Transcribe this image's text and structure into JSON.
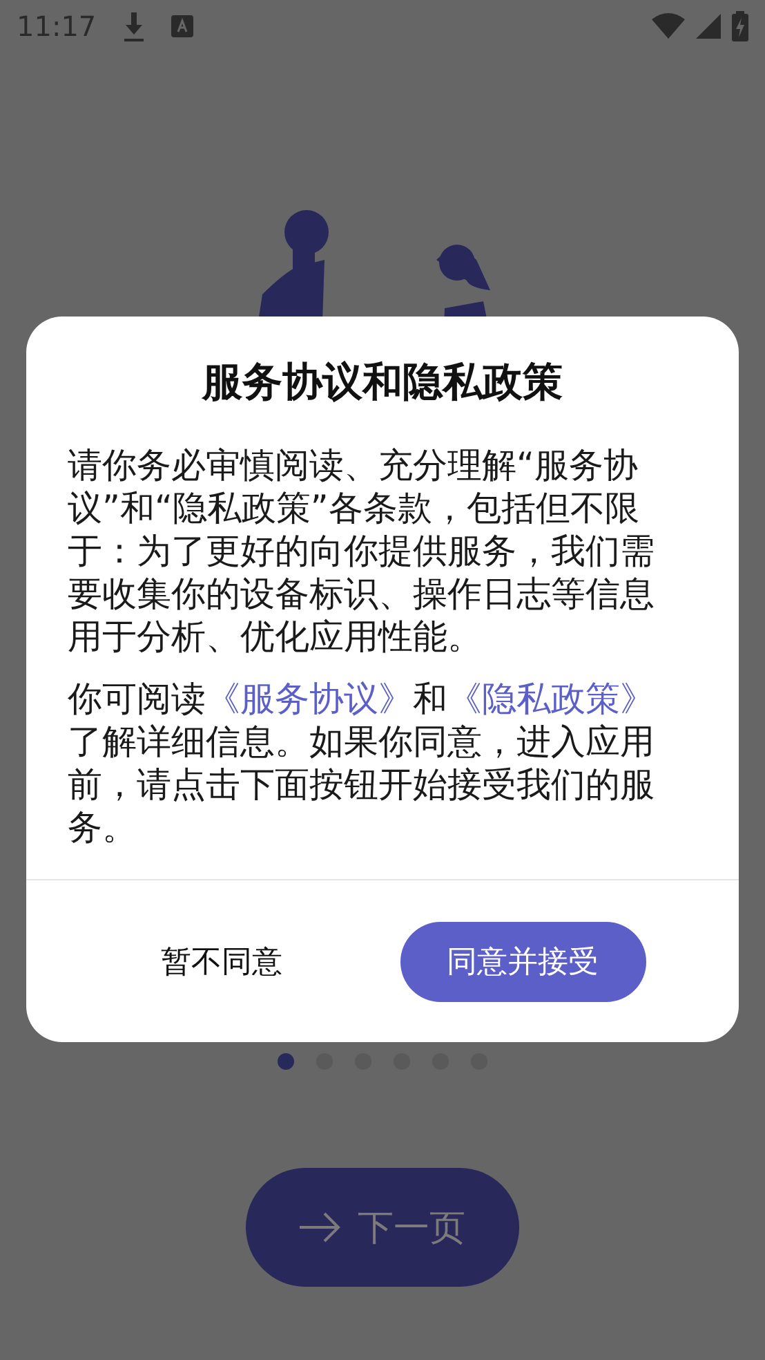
{
  "status_bar": {
    "time": "11:17"
  },
  "dialog": {
    "title": "服务协议和隐私政策",
    "paragraph_1": "请你务必审慎阅读、充分理解“服务协议”和“隐私政策”各条款，包括但不限于：为了更好的向你提供服务，我们需要收集你的设备标识、操作日志等信息用于分析、优化应用性能。",
    "paragraph_2": [
      {
        "kind": "text",
        "text": "你可阅读"
      },
      {
        "kind": "link",
        "text": "《服务协议》"
      },
      {
        "kind": "text",
        "text": "和"
      },
      {
        "kind": "link",
        "text": "《隐私政策》"
      },
      {
        "kind": "text",
        "text": "了解详细信息。如果你同意，进入应用前，请点击下面按钮开始接受我们的服务。"
      }
    ],
    "decline_button": "暂不同意",
    "accept_button": "同意并接受"
  },
  "page_dots": [
    {
      "selected": true
    },
    {
      "selected": false
    },
    {
      "selected": false
    },
    {
      "selected": false
    },
    {
      "selected": false
    },
    {
      "selected": false
    }
  ],
  "next_button": "下一页"
}
